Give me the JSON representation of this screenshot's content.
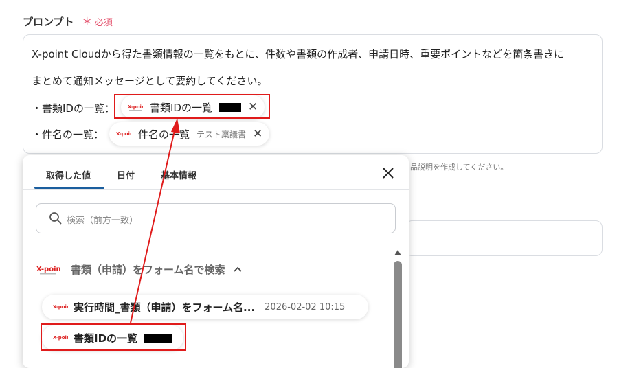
{
  "field": {
    "label": "プロンプト",
    "required_mark": "＊",
    "required_text": "必須"
  },
  "prompt": {
    "line1": "X-point Cloudから得た書類情報の一覧をもとに、件数や書類の作成者、申請日時、重要ポイントなどを箇条書きに",
    "line2": "まとめて通知メッセージとして要約してください。",
    "line3_prefix": "・書類IDの一覧：",
    "line4_prefix": "・件名の一覧：",
    "chip1_label": "書類IDの一覧",
    "chip2_label": "件名の一覧",
    "chip2_value": "テスト稟議書",
    "remove_glyph": "✕"
  },
  "background": {
    "hint_text": "品説明を作成してください。"
  },
  "panel": {
    "tabs": [
      "取得した値",
      "日付",
      "基本情報"
    ],
    "active_tab": 0,
    "close_glyph": "✕",
    "search_placeholder": "検索（前方一致）",
    "group_title": "書類（申請）をフォーム名で検索",
    "group_chevron": "^",
    "items": [
      {
        "label": "実行時間_書類（申請）をフォーム名...",
        "value": "2026-02-02 10:15"
      },
      {
        "label": "書類IDの一覧",
        "value": ""
      }
    ]
  },
  "colors": {
    "accent": "#1b5e9e",
    "required": "#e4506b",
    "highlight": "#e01b1b"
  },
  "icons": {
    "app_logo": "x-point-logo",
    "search": "search-icon",
    "close": "close-icon"
  }
}
